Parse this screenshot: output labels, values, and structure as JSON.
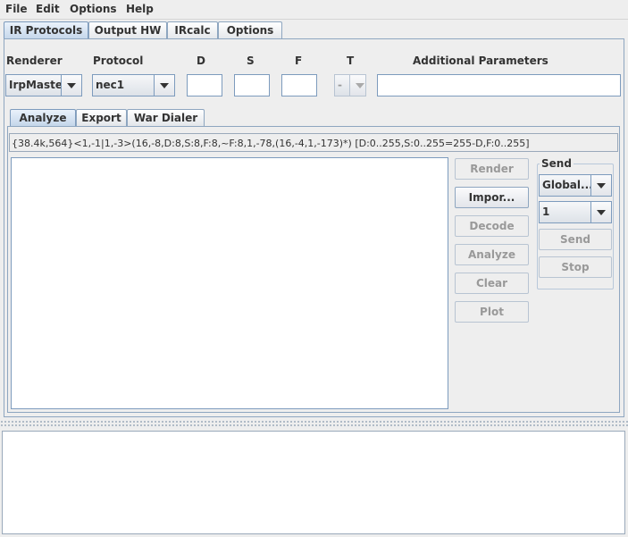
{
  "menubar": {
    "file": "File",
    "edit": "Edit",
    "options": "Options",
    "help": "Help"
  },
  "tabs": [
    "IR Protocols",
    "Output HW",
    "IRcalc",
    "Options"
  ],
  "params": {
    "renderer_label": "Renderer",
    "protocol_label": "Protocol",
    "d_label": "D",
    "s_label": "S",
    "f_label": "F",
    "t_label": "T",
    "additional_label": "Additional Parameters",
    "renderer_value": "IrpMaster",
    "protocol_value": "nec1",
    "d_value": "",
    "s_value": "",
    "f_value": "",
    "t_value": "-",
    "additional_value": ""
  },
  "subtabs": [
    "Analyze",
    "Export",
    "War Dialer"
  ],
  "irp": "{38.4k,564}<1,-1|1,-3>(16,-8,D:8,S:8,F:8,~F:8,1,-78,(16,-4,1,-173)*) [D:0..255,S:0..255=255-D,F:0..255]",
  "buttons": {
    "render": "Render",
    "import": "Impor...",
    "decode": "Decode",
    "analyze": "Analyze",
    "clear": "Clear",
    "plot": "Plot"
  },
  "send": {
    "title": "Send",
    "target_value": "Global...",
    "count_value": "1",
    "send_label": "Send",
    "stop_label": "Stop"
  },
  "colors": {
    "accent": "#7d9bbd",
    "selected_tab": "#c4d6ea"
  }
}
